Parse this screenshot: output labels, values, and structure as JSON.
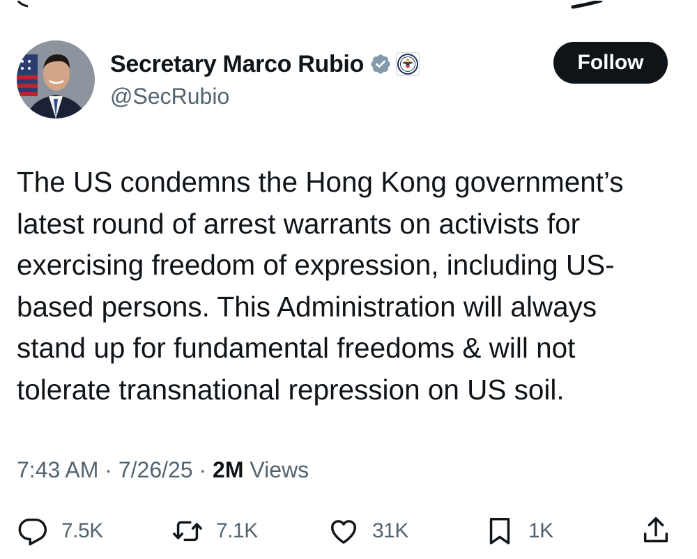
{
  "author": {
    "display_name": "Secretary Marco Rubio",
    "handle": "@SecRubio",
    "avatar_icon": "profile-photo",
    "verified_icon": "verified-badge-gray",
    "affiliate_icon": "state-department-seal"
  },
  "follow_label": "Follow",
  "tweet": {
    "text": "The US condemns the Hong Kong government’s\nlatest round of arrest warrants on activists for\nexercising freedom of expression, including US-\nbased persons. This Administration will always\nstand up for fundamental freedoms & will not\ntolerate transnational repression on US soil."
  },
  "meta": {
    "time": "7:43 AM",
    "separator": " · ",
    "date": "7/26/25",
    "views_count": "2M",
    "views_label": " Views"
  },
  "actions": {
    "replies": "7.5K",
    "reposts": "7.1K",
    "likes": "31K",
    "bookmarks": "1K"
  },
  "colors": {
    "text_primary": "#0f1419",
    "text_secondary": "#536471",
    "verified_gray": "#829aab",
    "button_bg": "#0f1419"
  }
}
